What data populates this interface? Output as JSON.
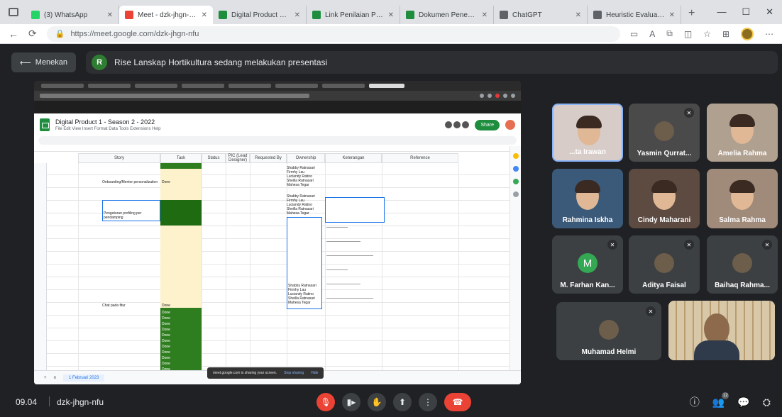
{
  "browser": {
    "tabs": [
      {
        "label": "(3) WhatsApp",
        "color": "#25d366",
        "active": false
      },
      {
        "label": "Meet - dzk-jhgn-nfu",
        "color": "#ea4335",
        "active": true
      },
      {
        "label": "Digital Product 1 - S",
        "color": "#1e8e3e",
        "active": false
      },
      {
        "label": "Link Penilaian Pelaporan",
        "color": "#1e8e3e",
        "active": false
      },
      {
        "label": "Dokumen Penentuan",
        "color": "#1e8e3e",
        "active": false
      },
      {
        "label": "ChatGPT",
        "color": "#5f6368",
        "active": false
      },
      {
        "label": "Heuristic Evaluation",
        "color": "#5f6368",
        "active": false
      }
    ],
    "new_tab": "+",
    "url": "https://meet.google.com/dzk-jhgn-nfu"
  },
  "meet": {
    "back_label": "Menekan",
    "presenter_initial": "R",
    "presenting_text": "Rise Lanskap Hortikultura sedang melakukan presentasi"
  },
  "sheet": {
    "title": "Digital Product 1 - Season 2 - 2022",
    "menu": "File  Edit  View  Insert  Format  Data  Tools  Extensions  Help",
    "share_label": "Share",
    "columns": [
      "Story",
      "Task",
      "Status",
      "PIC (Lead Designer)",
      "Requested By",
      "Ownership",
      "Keterangan",
      "Reference"
    ],
    "rows": [
      {
        "task": "Onboarding/Mentor personalization",
        "status": "Done"
      },
      {
        "task": "Pengaturan profiling per pendamping",
        "status": "Done"
      },
      {
        "task": "Chat pada fitur",
        "status": "Done"
      }
    ],
    "ownership_names": "Shabby Ratnasari\nFirmhy Lau\nLuciandy Ratino\nSheilla Ratnasari\nMahesa Tegar",
    "status_repeat": "Done",
    "sheet_tab": "1 Februari 2023",
    "toast_text": "meet.google.com is sharing your screen.",
    "toast_hide": "Hide",
    "toast_stop": "Stop sharing"
  },
  "participants": [
    {
      "name": "...ta Irawan",
      "kind": "video",
      "bg": "#d7ccc8"
    },
    {
      "name": "Yasmin Qurrat...",
      "kind": "photo",
      "bg": "#4a4a4a"
    },
    {
      "name": "Amelia Rahma",
      "kind": "video",
      "bg": "#b0a090"
    },
    {
      "name": "Rahmina Iskha",
      "kind": "video",
      "bg": "#3b5a7a"
    },
    {
      "name": "Cindy Maharani",
      "kind": "video",
      "bg": "#5d4a40"
    },
    {
      "name": "Salma Rahma",
      "kind": "video",
      "bg": "#a08a7a"
    },
    {
      "name": "M. Farhan Kan...",
      "kind": "letter",
      "initial": "M",
      "bg": "#3c4043"
    },
    {
      "name": "Aditya Faisal",
      "kind": "photo",
      "bg": "#3c4043"
    },
    {
      "name": "Baihaq Rahma...",
      "kind": "photo",
      "bg": "#3c4043"
    },
    {
      "name": "Muhamad Helmi",
      "kind": "photo",
      "bg": "#3c4043"
    },
    {
      "name": "",
      "kind": "self",
      "bg": "#c9b89a"
    }
  ],
  "bottom": {
    "time": "09.04",
    "meeting_code": "dzk-jhgn-nfu",
    "people_count": "12"
  },
  "colors": {
    "accent_red": "#ea4335",
    "sheet_green": "#2e7d1e",
    "background": "#202124"
  }
}
